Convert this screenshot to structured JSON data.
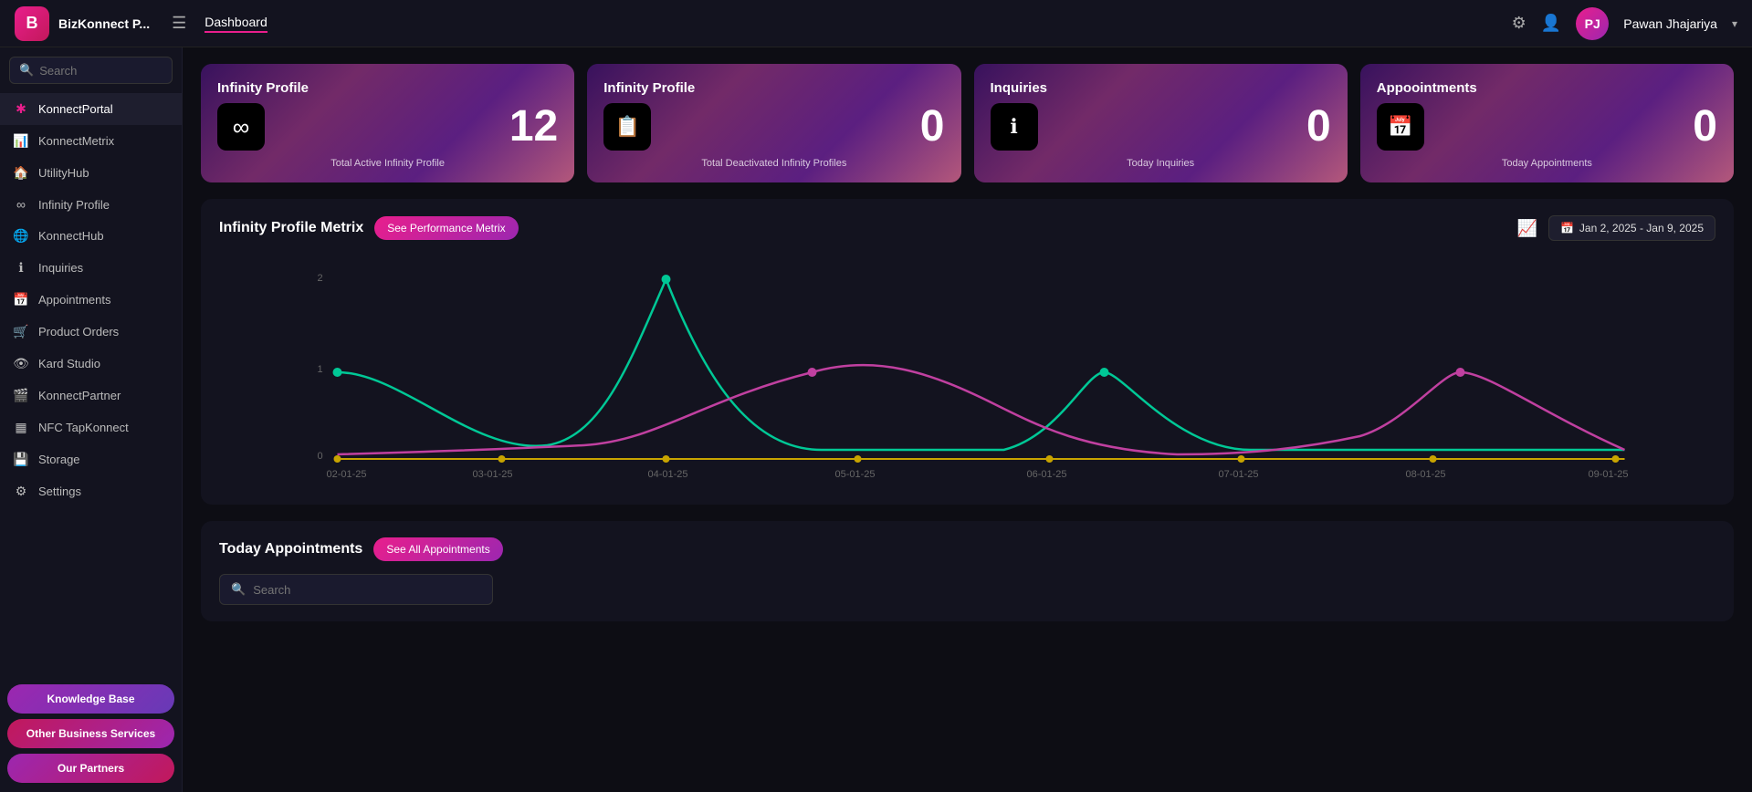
{
  "app": {
    "logo_letter": "B",
    "title": "BizKonnect P...",
    "nav_active": "Dashboard"
  },
  "topnav": {
    "title": "BizKonnect P...",
    "active_link": "Dashboard",
    "username": "Pawan Jhajariya",
    "chevron": "▾"
  },
  "sidebar": {
    "search_placeholder": "Search",
    "items": [
      {
        "label": "KonnectPortal",
        "icon": "✱",
        "active": true
      },
      {
        "label": "KonnectMetrix",
        "icon": "📊",
        "active": false
      },
      {
        "label": "UtilityHub",
        "icon": "🏠",
        "active": false
      },
      {
        "label": "Infinity Profile",
        "icon": "∞",
        "active": false
      },
      {
        "label": "KonnectHub",
        "icon": "🌐",
        "active": false
      },
      {
        "label": "Inquiries",
        "icon": "ℹ",
        "active": false
      },
      {
        "label": "Appointments",
        "icon": "📅",
        "active": false
      },
      {
        "label": "Product Orders",
        "icon": "🛒",
        "active": false
      },
      {
        "label": "Kard Studio",
        "icon": "👁",
        "active": false
      },
      {
        "label": "KonnectPartner",
        "icon": "🎬",
        "active": false
      },
      {
        "label": "NFC TapKonnect",
        "icon": "▦",
        "active": false
      },
      {
        "label": "Storage",
        "icon": "💾",
        "active": false
      },
      {
        "label": "Settings",
        "icon": "⚙",
        "active": false
      }
    ],
    "btn_kb": "Knowledge Base",
    "btn_obs": "Other Business Services",
    "btn_op": "Our Partners"
  },
  "stat_cards": [
    {
      "title": "Infinity Profile",
      "icon": "∞",
      "number": "12",
      "label": "Total Active Infinity Profile"
    },
    {
      "title": "Infinity Profile",
      "icon": "📋",
      "number": "0",
      "label": "Total Deactivated Infinity Profiles"
    },
    {
      "title": "Inquiries",
      "icon": "ℹ",
      "number": "0",
      "label": "Today Inquiries"
    },
    {
      "title": "Appoointments",
      "icon": "📅",
      "number": "0",
      "label": "Today Appointments"
    }
  ],
  "chart": {
    "title": "Infinity Profile Metrix",
    "btn_label": "See Performance Metrix",
    "date_range": "Jan 2, 2025 - Jan 9, 2025",
    "x_labels": [
      "02-01-25",
      "03-01-25",
      "04-01-25",
      "05-01-25",
      "06-01-25",
      "07-01-25",
      "08-01-25",
      "09-01-25"
    ],
    "y_labels": [
      "0",
      "1",
      "2"
    ]
  },
  "appointments": {
    "title": "Today Appointments",
    "btn_label": "See All Appointments",
    "search_placeholder": "Search"
  }
}
